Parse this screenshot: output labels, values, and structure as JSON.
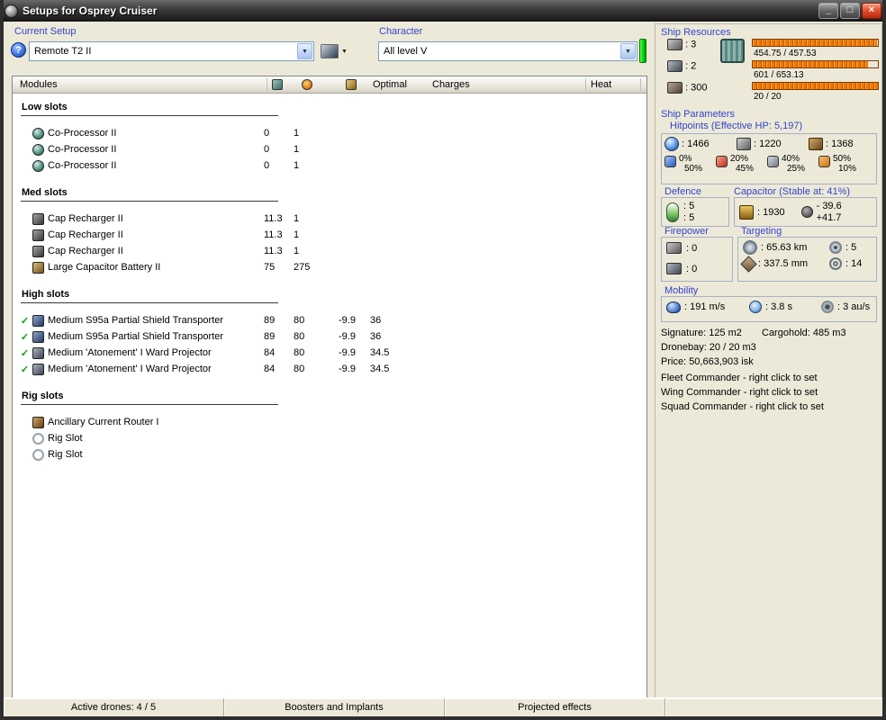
{
  "colors": {
    "label_blue": "#3344cc",
    "resource_bar_orange": "#f07800",
    "character_status_green": "#22dd22",
    "active_check_green": "#00a400"
  },
  "icons": {
    "help": "?",
    "dropdown_caret": "▼",
    "check": "✓",
    "minimize": "_",
    "maximize": "□",
    "close": "×"
  },
  "window": {
    "title": "Setups for Osprey Cruiser"
  },
  "toolbar": {
    "current_setup_label": "Current Setup",
    "current_setup_value": "Remote T2 II",
    "character_label": "Character",
    "character_value": "All level V"
  },
  "modules": {
    "title": "Modules",
    "columns": {
      "optimal": "Optimal",
      "charges": "Charges",
      "heat": "Heat"
    },
    "sections": [
      {
        "name": "Low slots",
        "rows": [
          {
            "check": "",
            "name": "Co-Processor II",
            "cpu": "0",
            "pg": "1",
            "cap": "",
            "optimal": ""
          },
          {
            "check": "",
            "name": "Co-Processor II",
            "cpu": "0",
            "pg": "1",
            "cap": "",
            "optimal": ""
          },
          {
            "check": "",
            "name": "Co-Processor II",
            "cpu": "0",
            "pg": "1",
            "cap": "",
            "optimal": ""
          }
        ]
      },
      {
        "name": "Med slots",
        "rows": [
          {
            "check": "",
            "name": "Cap Recharger II",
            "cpu": "11.3",
            "pg": "1",
            "cap": "",
            "optimal": ""
          },
          {
            "check": "",
            "name": "Cap Recharger II",
            "cpu": "11.3",
            "pg": "1",
            "cap": "",
            "optimal": ""
          },
          {
            "check": "",
            "name": "Cap Recharger II",
            "cpu": "11.3",
            "pg": "1",
            "cap": "",
            "optimal": ""
          },
          {
            "check": "",
            "name": "Large Capacitor Battery II",
            "cpu": "75",
            "pg": "275",
            "cap": "",
            "optimal": ""
          }
        ]
      },
      {
        "name": "High slots",
        "rows": [
          {
            "check": "✓",
            "name": "Medium S95a Partial Shield Transporter",
            "cpu": "89",
            "pg": "80",
            "cap": "-9.9",
            "optimal": "36"
          },
          {
            "check": "✓",
            "name": "Medium S95a Partial Shield Transporter",
            "cpu": "89",
            "pg": "80",
            "cap": "-9.9",
            "optimal": "36"
          },
          {
            "check": "✓",
            "name": "Medium 'Atonement' I Ward Projector",
            "cpu": "84",
            "pg": "80",
            "cap": "-9.9",
            "optimal": "34.5"
          },
          {
            "check": "✓",
            "name": "Medium 'Atonement' I Ward Projector",
            "cpu": "84",
            "pg": "80",
            "cap": "-9.9",
            "optimal": "34.5"
          }
        ]
      },
      {
        "name": "Rig slots",
        "rows": [
          {
            "check": "",
            "name": "Ancillary Current Router I",
            "cpu": "",
            "pg": "",
            "cap": "",
            "optimal": ""
          },
          {
            "check": "",
            "name": "Rig Slot",
            "cpu": "",
            "pg": "",
            "cap": "",
            "optimal": ""
          },
          {
            "check": "",
            "name": "Rig Slot",
            "cpu": "",
            "pg": "",
            "cap": "",
            "optimal": ""
          }
        ]
      }
    ]
  },
  "resources": {
    "label": "Ship Resources",
    "turrets": ": 3",
    "launchers": ": 2",
    "calibration": ": 300",
    "cpu_usage": "454.75 / 457.53",
    "powergrid_usage": "601 / 653.13",
    "upgrade_usage": "20 / 20"
  },
  "parameters": {
    "label": "Ship Parameters",
    "hitpoints": {
      "label": "Hitpoints (Effective HP: 5,197)",
      "shield": ": 1466",
      "armor": ": 1220",
      "hull": ": 1368",
      "resists": [
        {
          "shield": "0%",
          "armor": "50%"
        },
        {
          "shield": "20%",
          "armor": "45%"
        },
        {
          "shield": "40%",
          "armor": "25%"
        },
        {
          "shield": "50%",
          "armor": "10%"
        }
      ]
    },
    "defence": {
      "label": "Defence",
      "top": ": 5",
      "bottom": ": 5"
    },
    "capacitor": {
      "label": "Capacitor (Stable at: 41%)",
      "amount": ": 1930",
      "drain": "- 39.6",
      "recharge": "+41.7"
    },
    "firepower": {
      "label": "Firepower",
      "turret": ": 0",
      "missile": ": 0"
    },
    "targeting": {
      "label": "Targeting",
      "range": ": 65.63 km",
      "max_targets": ": 5",
      "scan_res": ": 337.5 mm",
      "sensor_strength": ": 14"
    },
    "mobility": {
      "label": "Mobility",
      "speed": ": 191 m/s",
      "align_time": ": 3.8 s",
      "warp_speed": ": 3 au/s"
    }
  },
  "summary": {
    "signature": "Signature: 125 m2",
    "cargohold": "Cargohold: 485 m3",
    "dronebay": "Dronebay: 20 / 20 m3",
    "price": "Price: 50,663,903 isk",
    "fleet": "Fleet Commander - right click to set",
    "wing": "Wing Commander - right click to set",
    "squad": "Squad Commander - right click to set"
  },
  "statusbar": {
    "drones": "Active drones: 4 / 5",
    "boosters": "Boosters and Implants",
    "projected": "Projected effects"
  }
}
